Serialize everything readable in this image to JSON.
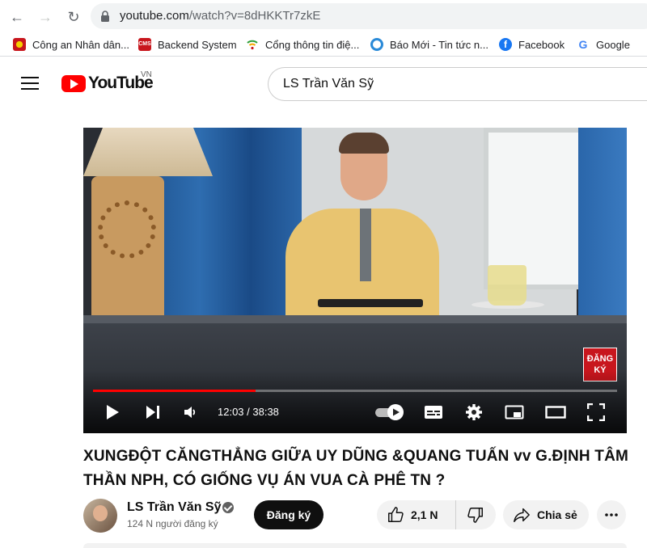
{
  "browser": {
    "url_host": "youtube.com",
    "url_path": "/watch?v=8dHKKTr7zkE",
    "bookmarks": [
      {
        "label": "Công an Nhân dân...",
        "icon": "cand-icon"
      },
      {
        "label": "Backend System",
        "icon": "cms-icon"
      },
      {
        "label": "Cổng thông tin điệ...",
        "icon": "wifi-icon"
      },
      {
        "label": "Báo Mới - Tin tức n...",
        "icon": "baomoi-icon"
      },
      {
        "label": "Facebook",
        "icon": "facebook-icon"
      },
      {
        "label": "Google",
        "icon": "google-icon"
      }
    ],
    "cms_badge": "CMS"
  },
  "header": {
    "logo_text": "YouTube",
    "country_code": "VN",
    "search_value": "LS Trần Văn Sỹ"
  },
  "player": {
    "current_time": "12:03",
    "duration": "38:38",
    "time_display": "12:03 / 38:38",
    "progress": 0.31,
    "overlay_badge_line1": "ĐĂNG",
    "overlay_badge_line2": "KÝ"
  },
  "video": {
    "title": "XUNGĐỘT CĂNGTHẲNG GIỮA UY DŨNG &QUANG TUẤN vv G.ĐỊNH TÂM THẦN NPH, CÓ GIỐNG VỤ ÁN VUA CÀ PHÊ TN ?"
  },
  "channel": {
    "name": "LS Trần Văn Sỹ",
    "subscribers": "124 N người đăng ký",
    "subscribe_label": "Đăng ký"
  },
  "actions": {
    "like_count": "2,1 N",
    "share_label": "Chia sẻ"
  },
  "colors": {
    "brand_red": "#ff0000",
    "subscribe_bg": "#0f0f0f",
    "pill_bg": "#f2f2f2"
  }
}
